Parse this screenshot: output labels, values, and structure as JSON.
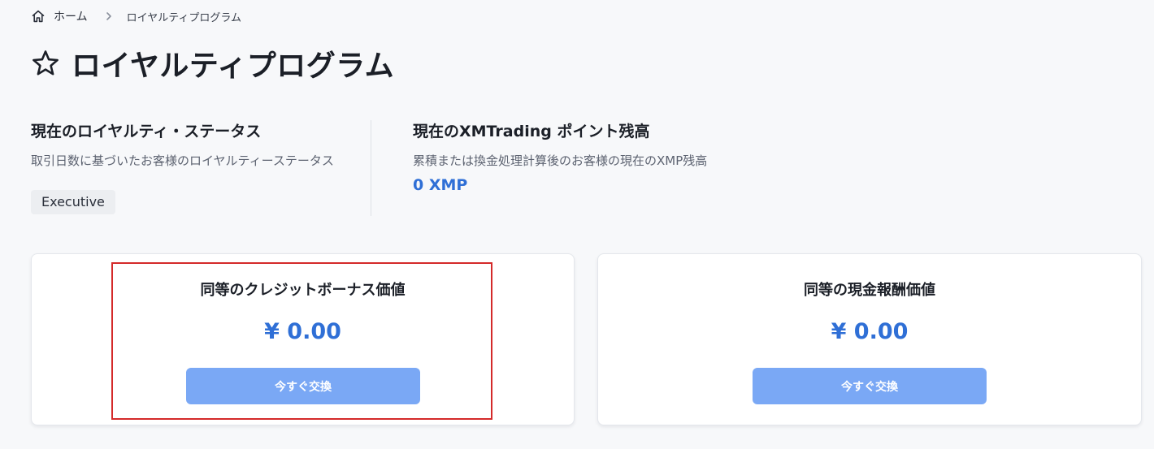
{
  "breadcrumb": {
    "home_label": "ホーム",
    "current_label": "ロイヤルティプログラム"
  },
  "page": {
    "title": "ロイヤルティプログラム"
  },
  "loyalty_status": {
    "heading": "現在のロイヤルティ・ステータス",
    "description": "取引日数に基づいたお客様のロイヤルティーステータス",
    "badge": "Executive"
  },
  "points_balance": {
    "heading": "現在のXMTrading ポイント残高",
    "description": "累積または換金処理計算後のお客様の現在のXMP残高",
    "value": "0 XMP"
  },
  "cards": {
    "credit": {
      "title": "同等のクレジットボーナス価値",
      "value": "¥ 0.00",
      "button_label": "今すぐ交換"
    },
    "cash": {
      "title": "同等の現金報酬価値",
      "value": "¥ 0.00",
      "button_label": "今すぐ交換"
    }
  },
  "colors": {
    "accent": "#2f6fd6",
    "button": "#7aa8f5",
    "highlight": "#d42a2a"
  },
  "icons": {
    "home": "home-icon",
    "separator": "chevron-right-icon",
    "title": "star-outline-icon"
  }
}
